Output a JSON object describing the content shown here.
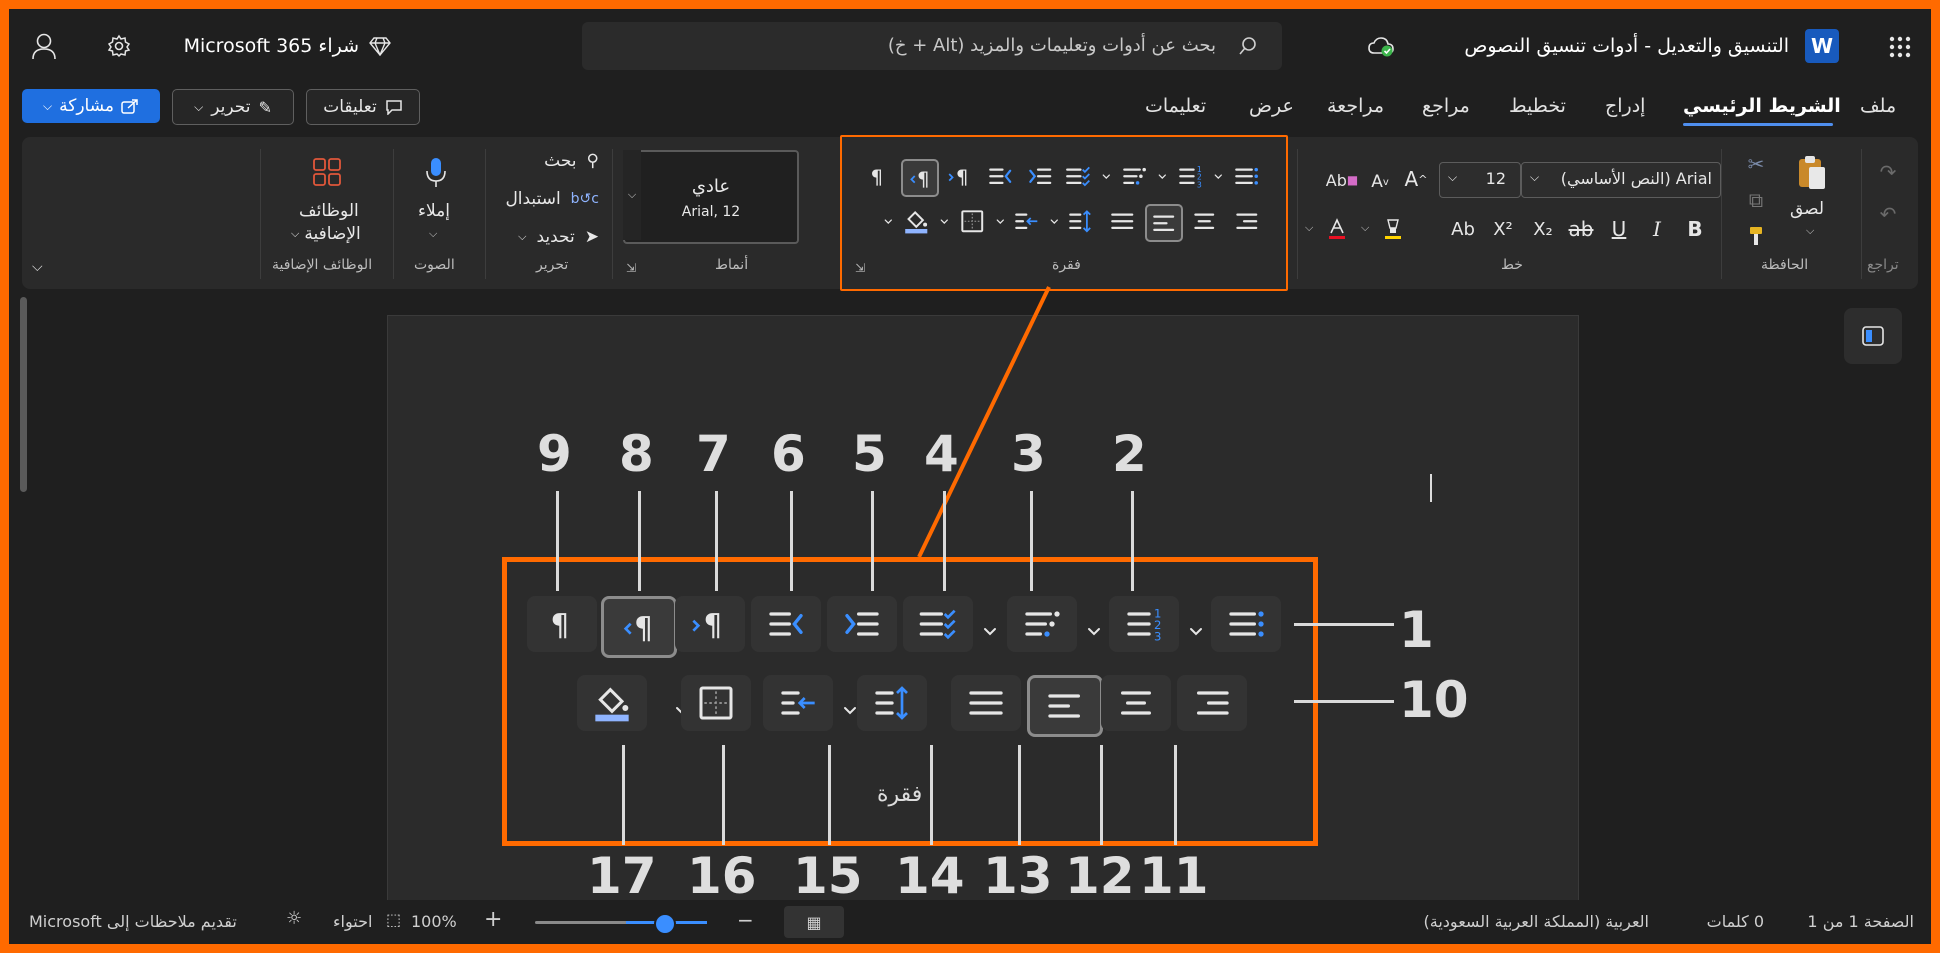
{
  "titlebar": {
    "doc_title": "التنسيق والتعديل - أدوات تنسيق النصوص",
    "search_placeholder": "بحث عن أدوات وتعليمات والمزيد (Alt + خ)",
    "buy_label": "شراء Microsoft 365",
    "app_icon_letter": "W"
  },
  "actions": {
    "share": "مشاركة",
    "edit": "تحرير",
    "comments": "تعليقات"
  },
  "tabs": [
    "ملف",
    "الشريط الرئيسي",
    "إدراج",
    "تخطيط",
    "مراجع",
    "مراجعة",
    "عرض",
    "تعليمات"
  ],
  "ribbon": {
    "undo_group": "تراجع",
    "clipboard_group": "الحافظة",
    "paste": "لصق",
    "font_group": "خط",
    "font_name": "Arial (النص الأساسي)",
    "font_size": "12",
    "paragraph_group": "فقرة",
    "styles_group": "أنماط",
    "style_name": "عادي",
    "style_font": "Arial, 12",
    "editing_group": "تحرير",
    "find": "بحث",
    "replace": "استبدال",
    "select": "تحديد",
    "voice_group": "الصوت",
    "dictate": "إملاء",
    "addins_group": "الوظائف الإضافية",
    "addins_line1": "الوظائف",
    "addins_line2": "الإضافية",
    "font_buttons": {
      "bold": "B",
      "italic": "I",
      "underline": "U",
      "strike": "ab",
      "sub": "X₂",
      "sup": "X²",
      "case": "Ab"
    }
  },
  "callout": {
    "group_label": "فقرة",
    "numbers_top": [
      "9",
      "8",
      "7",
      "6",
      "5",
      "4",
      "3",
      "2"
    ],
    "number_right_1": "1",
    "number_right_10": "10",
    "numbers_bottom": [
      "17",
      "16",
      "15",
      "14",
      "13",
      "12",
      "11"
    ]
  },
  "status": {
    "page": "الصفحة 1 من 1",
    "words": "0 كلمات",
    "language": "العربية (المملكة العربية السعودية)",
    "zoom": "100%",
    "fit": "احتواء",
    "feedback": "تقديم ملاحظات إلى Microsoft"
  },
  "colors": {
    "accent": "#1f6fe0",
    "highlight_border": "#ff6a00",
    "font_color": "#e81123",
    "highlighter": "#ffd400"
  }
}
